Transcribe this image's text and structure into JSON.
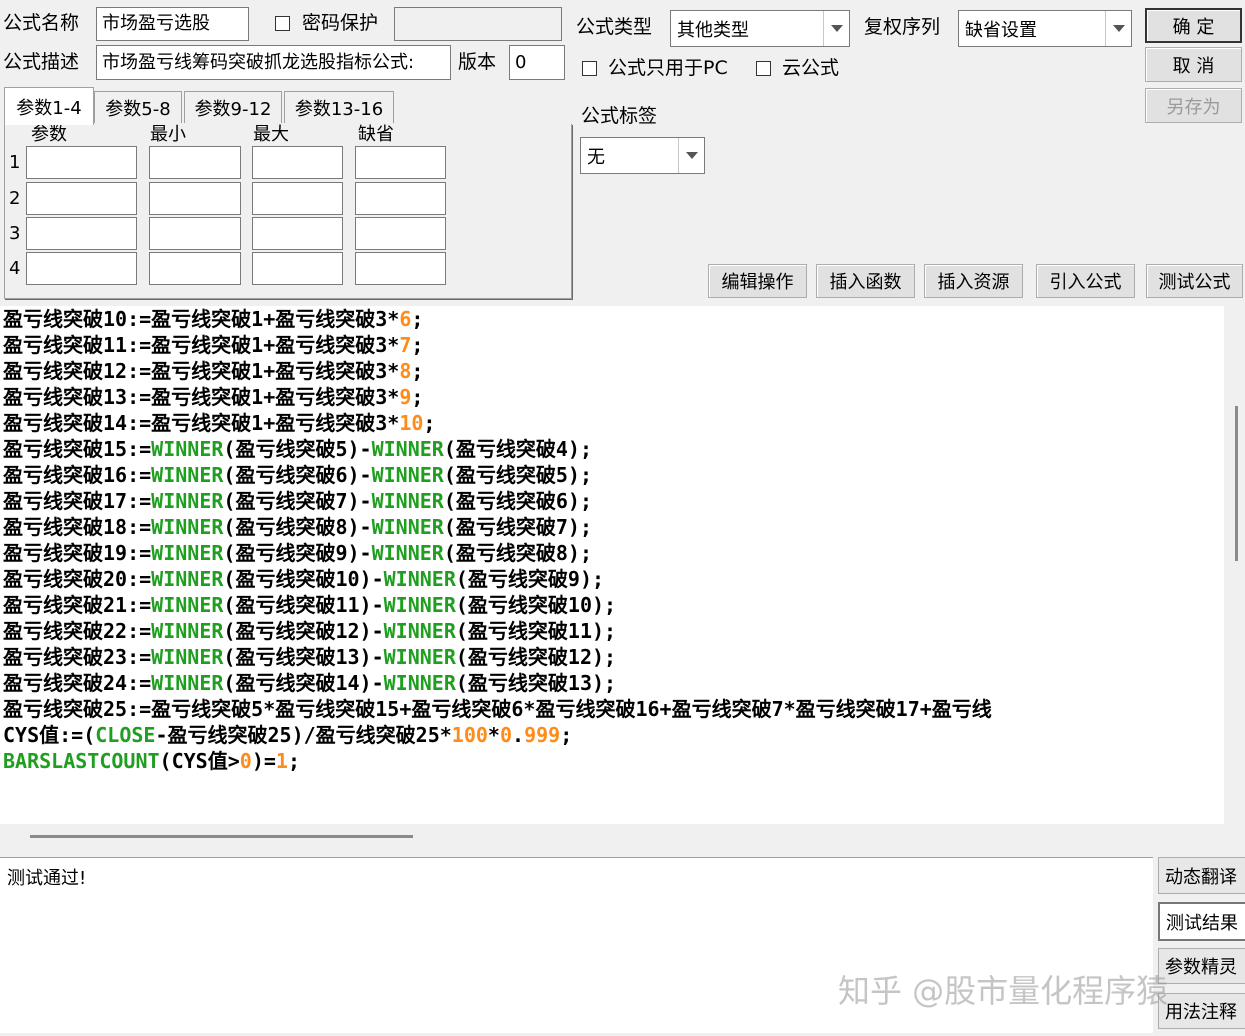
{
  "header": {
    "name_label": "公式名称",
    "name_value": "市场盈亏选股",
    "password_label": "密码保护",
    "desc_label": "公式描述",
    "desc_value": "市场盈亏线筹码突破抓龙选股指标公式:",
    "version_label": "版本",
    "version_value": "0",
    "type_label": "公式类型",
    "type_value": "其他类型",
    "adjust_label": "复权序列",
    "adjust_value": "缺省设置",
    "pc_only_label": "公式只用于PC",
    "cloud_label": "云公式",
    "tag_label": "公式标签",
    "tag_value": "无"
  },
  "buttons": {
    "ok": "确 定",
    "cancel": "取 消",
    "save_as": "另存为",
    "edit_ops": "编辑操作",
    "insert_func": "插入函数",
    "insert_res": "插入资源",
    "import_formula": "引入公式",
    "test_formula": "测试公式"
  },
  "tabs": [
    "参数1-4",
    "参数5-8",
    "参数9-12",
    "参数13-16"
  ],
  "params": {
    "headers": [
      "参数",
      "最小",
      "最大",
      "缺省"
    ],
    "rows": [
      "1",
      "2",
      "3",
      "4"
    ]
  },
  "code_lines": [
    [
      [
        "t",
        "盈亏线突破10:=盈亏线突破1+盈亏线突破3*"
      ],
      [
        "n",
        "6"
      ],
      [
        "t",
        ";"
      ]
    ],
    [
      [
        "t",
        "盈亏线突破11:=盈亏线突破1+盈亏线突破3*"
      ],
      [
        "n",
        "7"
      ],
      [
        "t",
        ";"
      ]
    ],
    [
      [
        "t",
        "盈亏线突破12:=盈亏线突破1+盈亏线突破3*"
      ],
      [
        "n",
        "8"
      ],
      [
        "t",
        ";"
      ]
    ],
    [
      [
        "t",
        "盈亏线突破13:=盈亏线突破1+盈亏线突破3*"
      ],
      [
        "n",
        "9"
      ],
      [
        "t",
        ";"
      ]
    ],
    [
      [
        "t",
        "盈亏线突破14:=盈亏线突破1+盈亏线突破3*"
      ],
      [
        "n",
        "10"
      ],
      [
        "t",
        ";"
      ]
    ],
    [
      [
        "t",
        "盈亏线突破15:="
      ],
      [
        "k",
        "WINNER"
      ],
      [
        "t",
        "(盈亏线突破5)-"
      ],
      [
        "k",
        "WINNER"
      ],
      [
        "t",
        "(盈亏线突破4);"
      ]
    ],
    [
      [
        "t",
        "盈亏线突破16:="
      ],
      [
        "k",
        "WINNER"
      ],
      [
        "t",
        "(盈亏线突破6)-"
      ],
      [
        "k",
        "WINNER"
      ],
      [
        "t",
        "(盈亏线突破5);"
      ]
    ],
    [
      [
        "t",
        "盈亏线突破17:="
      ],
      [
        "k",
        "WINNER"
      ],
      [
        "t",
        "(盈亏线突破7)-"
      ],
      [
        "k",
        "WINNER"
      ],
      [
        "t",
        "(盈亏线突破6);"
      ]
    ],
    [
      [
        "t",
        "盈亏线突破18:="
      ],
      [
        "k",
        "WINNER"
      ],
      [
        "t",
        "(盈亏线突破8)-"
      ],
      [
        "k",
        "WINNER"
      ],
      [
        "t",
        "(盈亏线突破7);"
      ]
    ],
    [
      [
        "t",
        "盈亏线突破19:="
      ],
      [
        "k",
        "WINNER"
      ],
      [
        "t",
        "(盈亏线突破9)-"
      ],
      [
        "k",
        "WINNER"
      ],
      [
        "t",
        "(盈亏线突破8);"
      ]
    ],
    [
      [
        "t",
        "盈亏线突破20:="
      ],
      [
        "k",
        "WINNER"
      ],
      [
        "t",
        "(盈亏线突破10)-"
      ],
      [
        "k",
        "WINNER"
      ],
      [
        "t",
        "(盈亏线突破9);"
      ]
    ],
    [
      [
        "t",
        "盈亏线突破21:="
      ],
      [
        "k",
        "WINNER"
      ],
      [
        "t",
        "(盈亏线突破11)-"
      ],
      [
        "k",
        "WINNER"
      ],
      [
        "t",
        "(盈亏线突破10);"
      ]
    ],
    [
      [
        "t",
        "盈亏线突破22:="
      ],
      [
        "k",
        "WINNER"
      ],
      [
        "t",
        "(盈亏线突破12)-"
      ],
      [
        "k",
        "WINNER"
      ],
      [
        "t",
        "(盈亏线突破11);"
      ]
    ],
    [
      [
        "t",
        "盈亏线突破23:="
      ],
      [
        "k",
        "WINNER"
      ],
      [
        "t",
        "(盈亏线突破13)-"
      ],
      [
        "k",
        "WINNER"
      ],
      [
        "t",
        "(盈亏线突破12);"
      ]
    ],
    [
      [
        "t",
        "盈亏线突破24:="
      ],
      [
        "k",
        "WINNER"
      ],
      [
        "t",
        "(盈亏线突破14)-"
      ],
      [
        "k",
        "WINNER"
      ],
      [
        "t",
        "(盈亏线突破13);"
      ]
    ],
    [
      [
        "t",
        "盈亏线突破25:=盈亏线突破5*盈亏线突破15+盈亏线突破6*盈亏线突破16+盈亏线突破7*盈亏线突破17+盈亏线"
      ]
    ],
    [
      [
        "t",
        "CYS值:=("
      ],
      [
        "k",
        "CLOSE"
      ],
      [
        "t",
        "-盈亏线突破25)/盈亏线突破25*"
      ],
      [
        "n",
        "100"
      ],
      [
        "t",
        "*"
      ],
      [
        "n",
        "0"
      ],
      [
        "t",
        "."
      ],
      [
        "n",
        "999"
      ],
      [
        "t",
        ";"
      ]
    ],
    [
      [
        "k",
        "BARSLASTCOUNT"
      ],
      [
        "t",
        "(CYS值>"
      ],
      [
        "n",
        "0"
      ],
      [
        "t",
        ")="
      ],
      [
        "n",
        "1"
      ],
      [
        "t",
        ";"
      ]
    ]
  ],
  "status": {
    "message": "测试通过!"
  },
  "side_buttons": [
    "动态翻译",
    "测试结果",
    "参数精灵",
    "用法注释"
  ],
  "watermark": "知乎 @股市量化程序猿",
  "colors": {
    "keyword": "#1f9e1f",
    "number": "#ff8c1a"
  }
}
